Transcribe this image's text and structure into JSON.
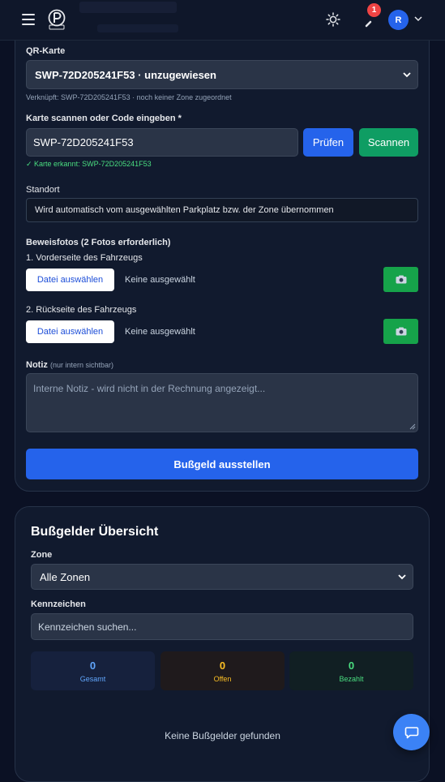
{
  "header": {
    "notification_count": "1",
    "avatar_initial": "R"
  },
  "fine_form": {
    "qr_card": {
      "label": "QR-Karte",
      "selected": "SWP-72D205241F53 · unzugewiesen",
      "hint": "Verknüpft: SWP-72D205241F53 · noch keiner Zone zugeordnet"
    },
    "scan": {
      "label": "Karte scannen oder Code eingeben *",
      "value": "SWP-72D205241F53",
      "check_button": "Prüfen",
      "scan_button": "Scannen",
      "recognized": "✓ Karte erkannt: SWP-72D205241F53"
    },
    "location": {
      "label": "Standort",
      "value": "Wird automatisch vom ausgewählten Parkplatz bzw. der Zone übernommen"
    },
    "photos": {
      "label": "Beweisfotos (2 Fotos erforderlich)",
      "front_label": "1. Vorderseite des Fahrzeugs",
      "back_label": "2. Rückseite des Fahrzeugs",
      "choose_file": "Datei auswählen",
      "none_selected": "Keine ausgewählt",
      "camera_icon": "camera-icon"
    },
    "note": {
      "label": "Notiz",
      "sublabel": "(nur intern sichtbar)",
      "placeholder": "Interne Notiz - wird nicht in der Rechnung angezeigt..."
    },
    "submit": "Bußgeld ausstellen"
  },
  "overview": {
    "title": "Bußgelder Übersicht",
    "zone_label": "Zone",
    "zone_selected": "Alle Zonen",
    "plate_label": "Kennzeichen",
    "plate_placeholder": "Kennzeichen suchen...",
    "stats": [
      {
        "value": "0",
        "label": "Gesamt",
        "color": "#60a5fa"
      },
      {
        "value": "0",
        "label": "Offen",
        "color": "#fbbf24"
      },
      {
        "value": "0",
        "label": "Bezahlt",
        "color": "#4ade80"
      }
    ],
    "empty_text": "Keine Bußgelder gefunden"
  }
}
